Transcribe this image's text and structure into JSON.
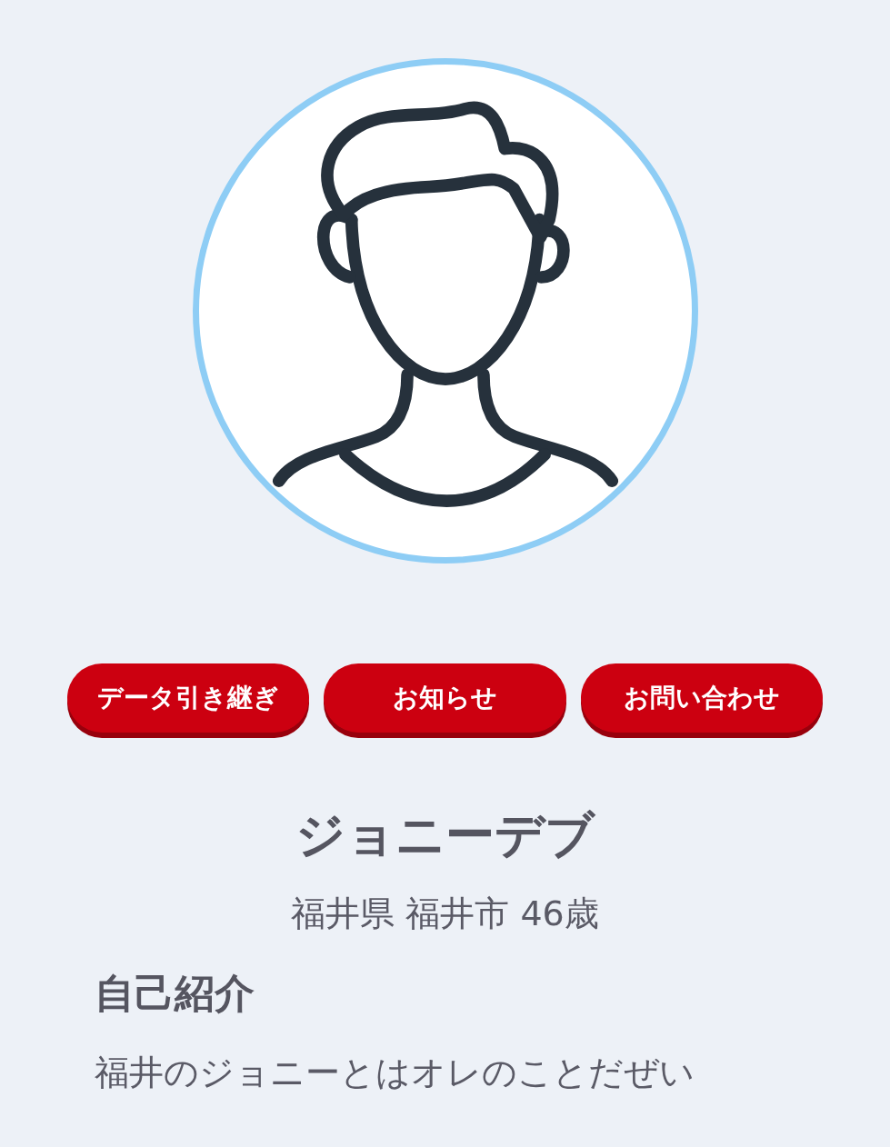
{
  "buttons": [
    {
      "label": "データ引き継ぎ"
    },
    {
      "label": "お知らせ"
    },
    {
      "label": "お問い合わせ"
    }
  ],
  "profile": {
    "name": "ジョニーデブ",
    "location": "福井県 福井市 46歳"
  },
  "intro": {
    "heading": "自己紹介",
    "text": "福井のジョニーとはオレのことだぜい"
  }
}
